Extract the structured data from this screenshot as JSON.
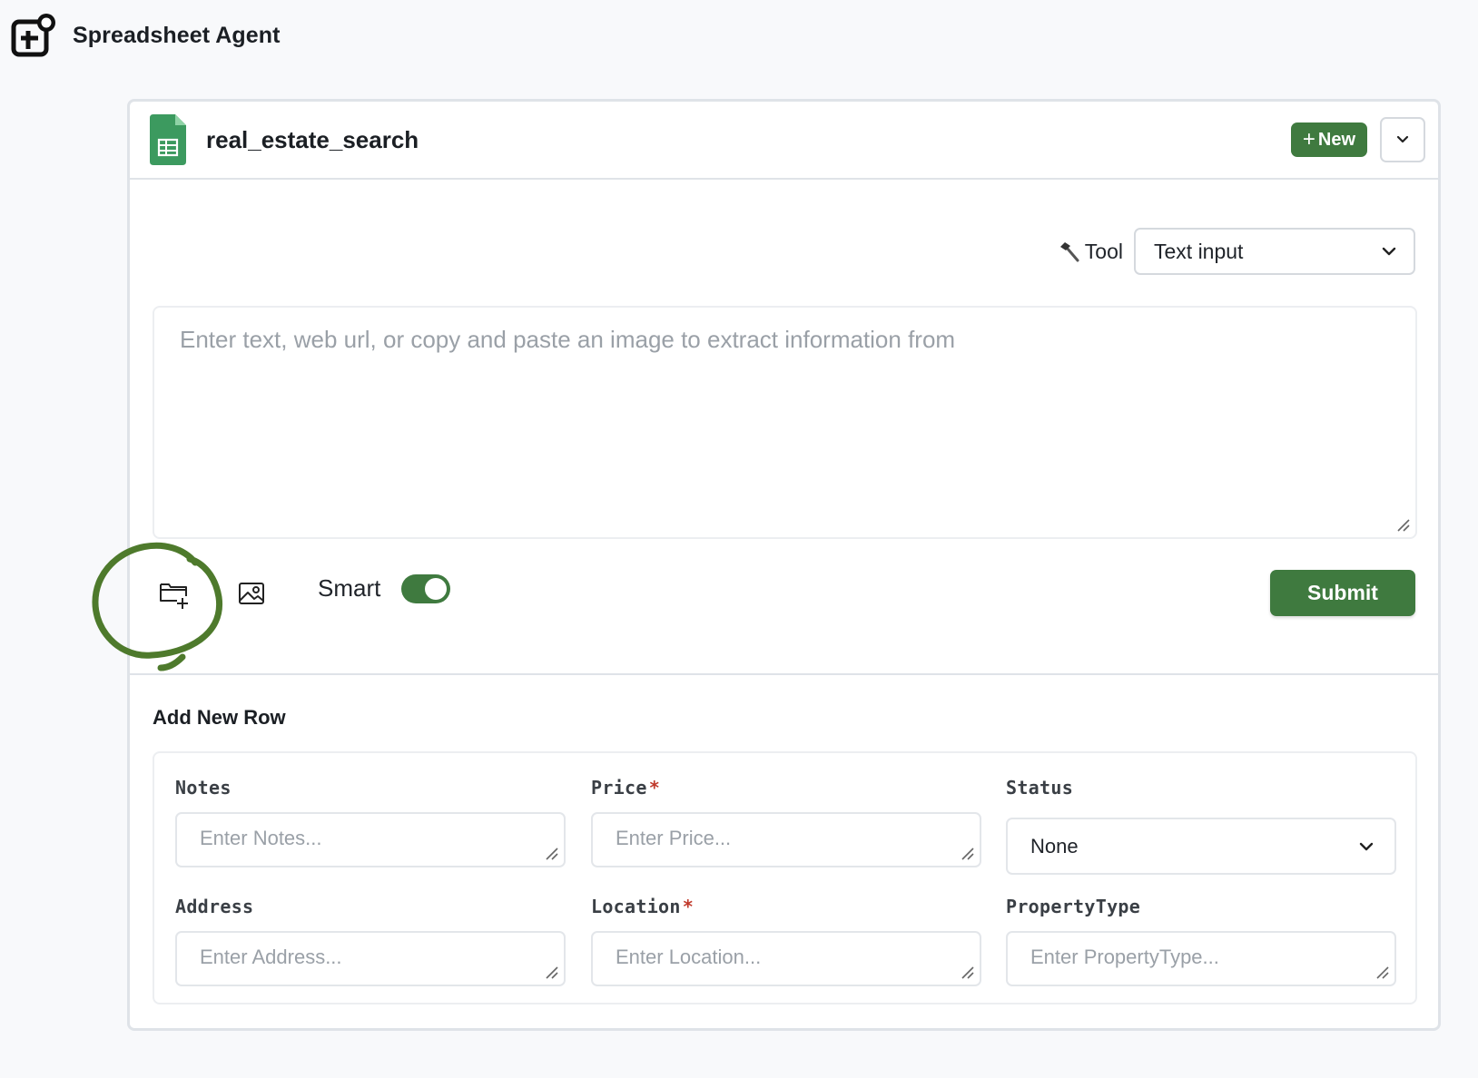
{
  "app": {
    "title": "Spreadsheet Agent",
    "logo_icon": "spreadsheet-agent-logo-icon"
  },
  "sheet": {
    "name": "real_estate_search",
    "icon": "google-sheets-icon"
  },
  "header": {
    "new_label": "New",
    "new_icon": "plus-icon",
    "menu_icon": "chevron-down-icon"
  },
  "tool": {
    "icon": "hammer-icon",
    "label": "Tool",
    "selected": "Text input"
  },
  "input": {
    "placeholder": "Enter text, web url, or copy and paste an image to extract information from",
    "value": ""
  },
  "actions": {
    "upload_icon": "folder-plus-icon",
    "image_icon": "image-icon",
    "smart_label": "Smart",
    "smart_enabled": true,
    "submit_label": "Submit"
  },
  "add_row": {
    "title": "Add New Row",
    "fields": [
      {
        "label": "Notes",
        "required": false,
        "type": "text",
        "placeholder": "Enter Notes..."
      },
      {
        "label": "Price",
        "required": true,
        "type": "text",
        "placeholder": "Enter Price..."
      },
      {
        "label": "Status",
        "required": false,
        "type": "select",
        "value": "None"
      },
      {
        "label": "Address",
        "required": false,
        "type": "text",
        "placeholder": "Enter Address..."
      },
      {
        "label": "Location",
        "required": true,
        "type": "text",
        "placeholder": "Enter Location..."
      },
      {
        "label": "PropertyType",
        "required": false,
        "type": "text",
        "placeholder": "Enter PropertyType..."
      }
    ]
  },
  "colors": {
    "accent": "#3f7a3f",
    "border": "#dfe3e8",
    "required": "#c0392b",
    "placeholder": "#9aa0a7",
    "annotation": "#4e7a2c"
  }
}
